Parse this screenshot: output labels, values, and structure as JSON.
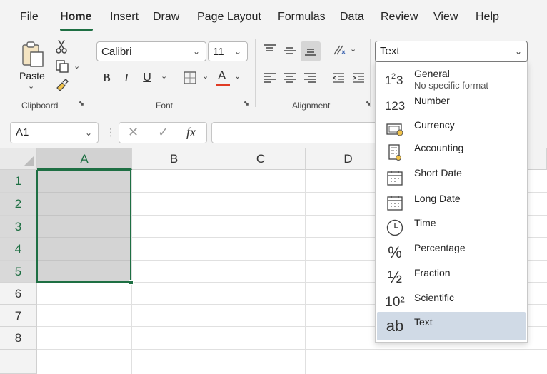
{
  "tabs": [
    {
      "label": "File",
      "active": false
    },
    {
      "label": "Home",
      "active": true
    },
    {
      "label": "Insert",
      "active": false
    },
    {
      "label": "Draw",
      "active": false
    },
    {
      "label": "Page Layout",
      "active": false
    },
    {
      "label": "Formulas",
      "active": false
    },
    {
      "label": "Data",
      "active": false
    },
    {
      "label": "Review",
      "active": false
    },
    {
      "label": "View",
      "active": false
    },
    {
      "label": "Help",
      "active": false
    }
  ],
  "clipboard": {
    "paste_label": "Paste",
    "group_label": "Clipboard"
  },
  "font": {
    "name": "Calibri",
    "size": "11",
    "group_label": "Font",
    "bold": "B",
    "italic": "I",
    "underline": "U",
    "color_letter": "A",
    "font_color": "#e03b24"
  },
  "alignment": {
    "group_label": "Alignment"
  },
  "number_format": {
    "selected": "Text"
  },
  "formula_bar": {
    "cell_ref": "A1",
    "fx": "fx",
    "cancel": "✕",
    "enter": "✓",
    "value": ""
  },
  "grid": {
    "columns": [
      "A",
      "B",
      "C",
      "D"
    ],
    "rows": [
      "1",
      "2",
      "3",
      "4",
      "5",
      "6",
      "7",
      "8"
    ]
  },
  "format_menu": [
    {
      "label": "General",
      "sub": "No specific format",
      "icon": "general-number-icon",
      "glyph": "1²3"
    },
    {
      "label": "Number",
      "icon": "number-icon",
      "glyph": "123"
    },
    {
      "label": "Currency",
      "icon": "currency-icon",
      "glyph": ""
    },
    {
      "label": "Accounting",
      "icon": "accounting-icon",
      "glyph": ""
    },
    {
      "label": "Short Date",
      "icon": "short-date-calendar-icon",
      "glyph": ""
    },
    {
      "label": "Long Date",
      "icon": "long-date-calendar-icon",
      "glyph": ""
    },
    {
      "label": "Time",
      "icon": "clock-icon",
      "glyph": ""
    },
    {
      "label": "Percentage",
      "icon": "percent-icon",
      "glyph": "%"
    },
    {
      "label": "Fraction",
      "icon": "fraction-icon",
      "glyph": "½"
    },
    {
      "label": "Scientific",
      "icon": "scientific-icon",
      "glyph": "10²"
    },
    {
      "label": "Text",
      "icon": "text-ab-icon",
      "glyph": "ab",
      "selected": true
    }
  ],
  "colors": {
    "accent": "#1e6f43",
    "selection_fill": "#d4d4d4",
    "menu_highlight": "#d0dae6"
  }
}
